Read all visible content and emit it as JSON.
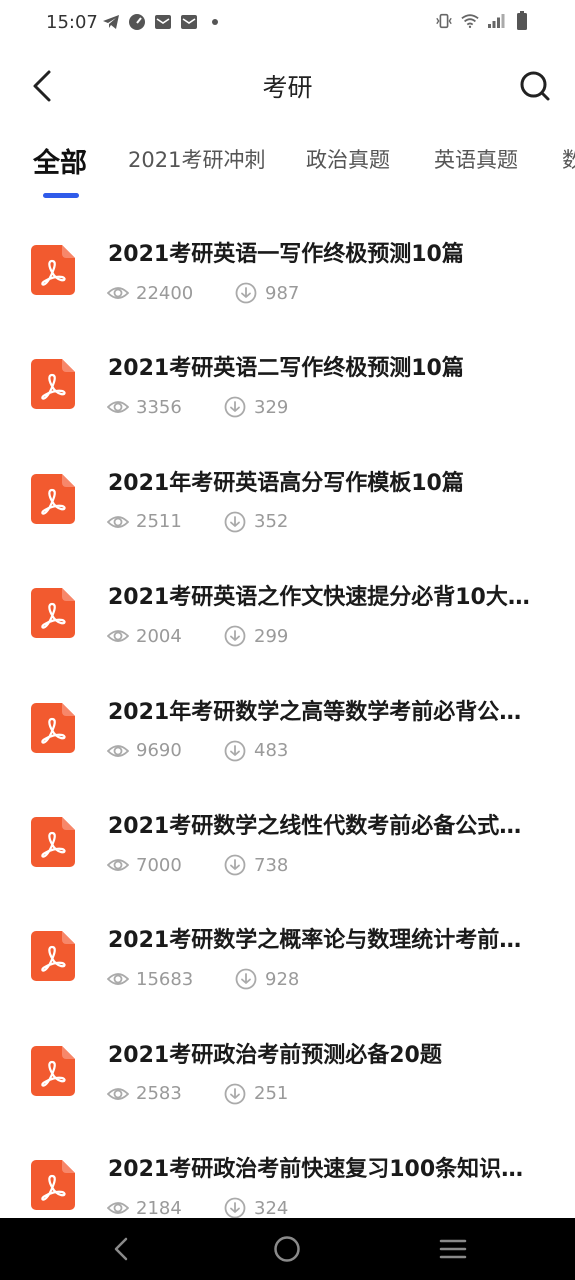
{
  "status_bar": {
    "time": "15:07",
    "left_icons": [
      "telegram-icon",
      "speedometer-icon",
      "mail-icon",
      "mail-icon",
      "dot-icon"
    ],
    "right_icons": [
      "vibrate-icon",
      "wifi-icon",
      "signal-icon",
      "battery-icon"
    ]
  },
  "header": {
    "title": "考研",
    "back_icon": "chevron-left-icon",
    "search_icon": "search-icon"
  },
  "tabs": [
    {
      "label": "全部",
      "active": true
    },
    {
      "label": "2021考研冲刺",
      "active": false
    },
    {
      "label": "政治真题",
      "active": false
    },
    {
      "label": "英语真题",
      "active": false
    },
    {
      "label": "数",
      "active": false
    }
  ],
  "documents": [
    {
      "title": "2021考研英语一写作终极预测10篇",
      "views": "22400",
      "downloads": "987"
    },
    {
      "title": "2021考研英语二写作终极预测10篇",
      "views": "3356",
      "downloads": "329"
    },
    {
      "title": "2021年考研英语高分写作模板10篇",
      "views": "2511",
      "downloads": "352"
    },
    {
      "title": "2021考研英语之作文快速提分必背10大…",
      "views": "2004",
      "downloads": "299"
    },
    {
      "title": "2021年考研数学之高等数学考前必背公…",
      "views": "9690",
      "downloads": "483"
    },
    {
      "title": "2021考研数学之线性代数考前必备公式…",
      "views": "7000",
      "downloads": "738"
    },
    {
      "title": "2021考研数学之概率论与数理统计考前…",
      "views": "15683",
      "downloads": "928"
    },
    {
      "title": "2021考研政治考前预测必备20题",
      "views": "2583",
      "downloads": "251"
    },
    {
      "title": "2021考研政治考前快速复习100条知识…",
      "views": "2184",
      "downloads": "324"
    }
  ],
  "colors": {
    "accent": "#2f5bea",
    "pdf_icon": "#f25a2f",
    "meta_text": "#9a9a9a",
    "nav_bar": "#000000"
  },
  "nav_bar": {
    "icons": [
      "back-triangle-icon",
      "home-circle-icon",
      "recents-menu-icon"
    ]
  }
}
